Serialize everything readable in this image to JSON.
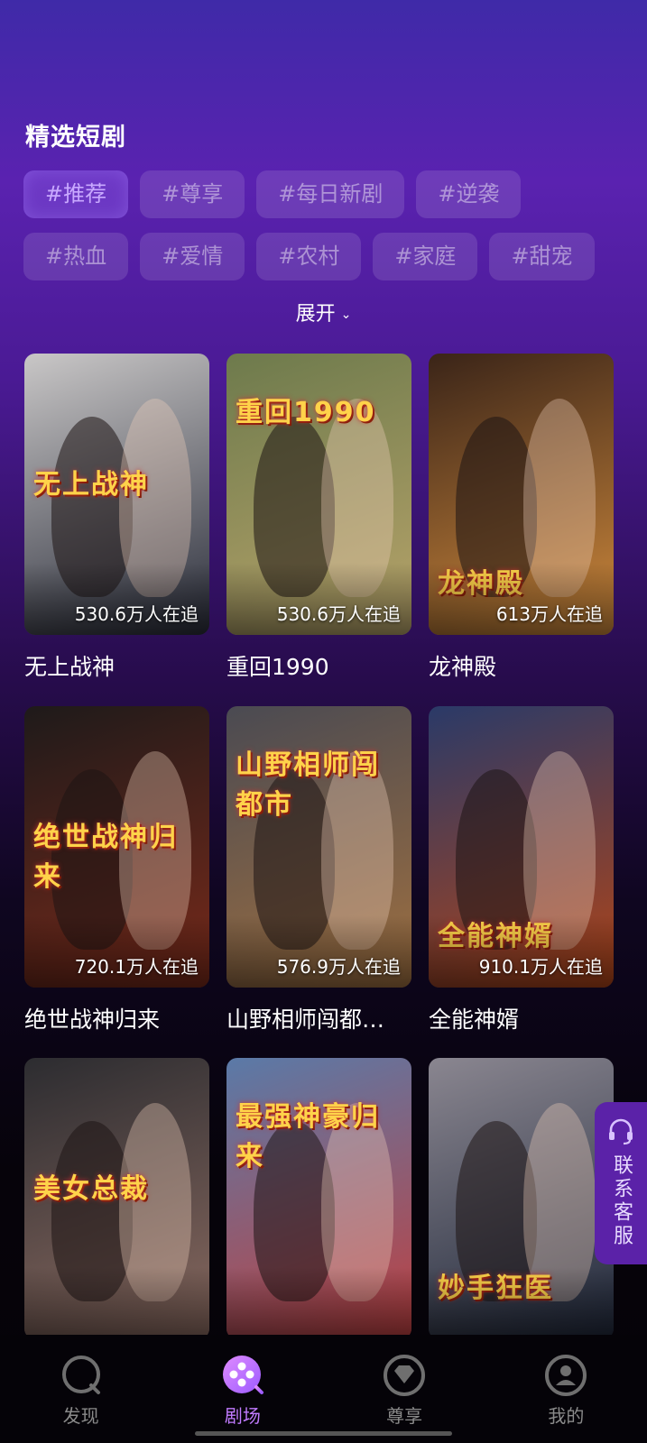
{
  "section": {
    "title": "精选短剧"
  },
  "tags": {
    "row1": [
      {
        "label": "#推荐",
        "active": true
      },
      {
        "label": "#尊享",
        "active": false
      },
      {
        "label": "#每日新剧",
        "active": false
      },
      {
        "label": "#逆袭",
        "active": false
      }
    ],
    "row2": [
      {
        "label": "#热血",
        "active": false
      },
      {
        "label": "#爱情",
        "active": false
      },
      {
        "label": "#农村",
        "active": false
      },
      {
        "label": "#家庭",
        "active": false
      },
      {
        "label": "#甜宠",
        "active": false
      }
    ],
    "expand_label": "展开"
  },
  "dramas": [
    {
      "title": "无上战神",
      "followers": "530.6万人在追",
      "art_text": "无上战神",
      "colors": [
        "#c9c7c7",
        "#2a2d3a"
      ]
    },
    {
      "title": "重回1990",
      "followers": "530.6万人在追",
      "art_text": "重回1990",
      "colors": [
        "#6d7a4c",
        "#b8a46a"
      ]
    },
    {
      "title": "龙神殿",
      "followers": "613万人在追",
      "art_text": "龙神殿",
      "colors": [
        "#3a2418",
        "#d08a3c"
      ]
    },
    {
      "title": "绝世战神归来",
      "followers": "720.1万人在追",
      "art_text": "绝世战神归来",
      "colors": [
        "#1e1a1a",
        "#7a2a1a"
      ]
    },
    {
      "title": "山野相师闯都…",
      "followers": "576.9万人在追",
      "art_text": "山野相师闯都市",
      "colors": [
        "#4a4a52",
        "#a07040"
      ]
    },
    {
      "title": "全能神婿",
      "followers": "910.1万人在追",
      "art_text": "全能神婿",
      "colors": [
        "#2a3a68",
        "#b04418"
      ]
    },
    {
      "title": "",
      "followers": "",
      "art_text": "美女总裁",
      "colors": [
        "#2c2c30",
        "#8a6a60"
      ]
    },
    {
      "title": "",
      "followers": "",
      "art_text": "最强神豪归来",
      "colors": [
        "#5a7aa8",
        "#c04040"
      ]
    },
    {
      "title": "",
      "followers": "",
      "art_text": "妙手狂医",
      "colors": [
        "#8a8690",
        "#20283a"
      ]
    }
  ],
  "service": {
    "label": "联系客服",
    "icon": "headset-icon"
  },
  "tabbar": {
    "tabs": [
      {
        "label": "发现",
        "icon": "discover-icon",
        "active": false
      },
      {
        "label": "剧场",
        "icon": "theater-icon",
        "active": true
      },
      {
        "label": "尊享",
        "icon": "diamond-icon",
        "active": false
      },
      {
        "label": "我的",
        "icon": "profile-icon",
        "active": false
      }
    ]
  },
  "colors": {
    "accent": "#c17bff",
    "service_bg": "#5b22a8"
  }
}
